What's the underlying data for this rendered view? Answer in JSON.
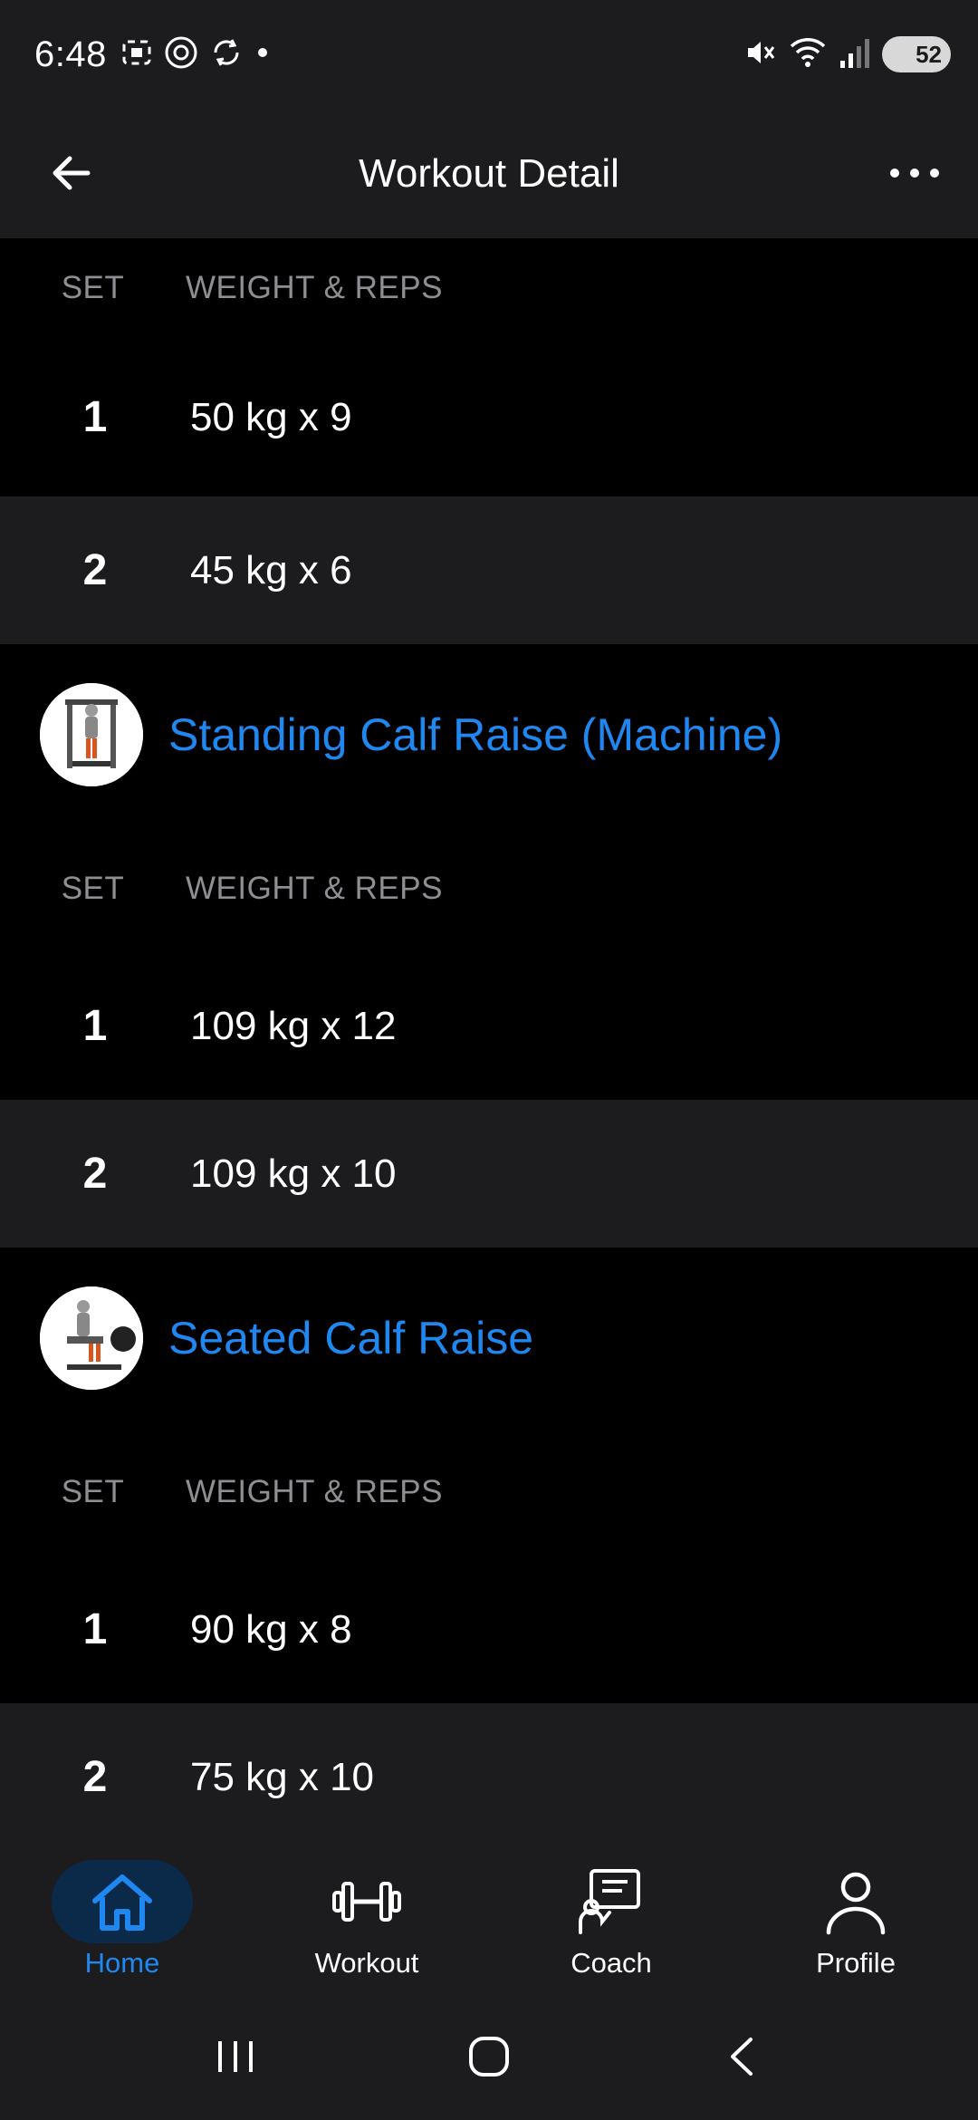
{
  "status_bar": {
    "time": "6:48",
    "battery": "52",
    "icons": [
      "screenshot-icon",
      "threads-icon",
      "sync-icon",
      "dot-icon",
      "mute-icon",
      "wifi-icon",
      "signal-icon",
      "battery-icon"
    ]
  },
  "header": {
    "title": "Workout Detail",
    "back_icon": "arrow-left-icon",
    "more_icon": "more-horizontal-icon"
  },
  "columns": {
    "set": "SET",
    "weight_reps": "WEIGHT & REPS"
  },
  "exercises": [
    {
      "title": "",
      "sets": [
        {
          "set": "1",
          "value": "50 kg x 9"
        },
        {
          "set": "2",
          "value": "45 kg x 6"
        }
      ]
    },
    {
      "title": "Standing Calf Raise (Machine)",
      "sets": [
        {
          "set": "1",
          "value": "109 kg x 12"
        },
        {
          "set": "2",
          "value": "109 kg x 10"
        }
      ]
    },
    {
      "title": "Seated Calf Raise",
      "sets": [
        {
          "set": "1",
          "value": "90 kg x 8"
        },
        {
          "set": "2",
          "value": "75 kg x 10"
        }
      ]
    }
  ],
  "bottom_nav": {
    "items": [
      {
        "label": "Home",
        "icon": "home-icon",
        "active": true
      },
      {
        "label": "Workout",
        "icon": "dumbbell-icon",
        "active": false
      },
      {
        "label": "Coach",
        "icon": "coach-icon",
        "active": false
      },
      {
        "label": "Profile",
        "icon": "profile-icon",
        "active": false
      }
    ]
  },
  "system_nav": [
    "recents-icon",
    "home-circle-icon",
    "back-chevron-icon"
  ],
  "colors": {
    "accent": "#1e88f0",
    "background": "#000000",
    "surface": "#1c1c1e",
    "muted_text": "#8e8e93"
  }
}
